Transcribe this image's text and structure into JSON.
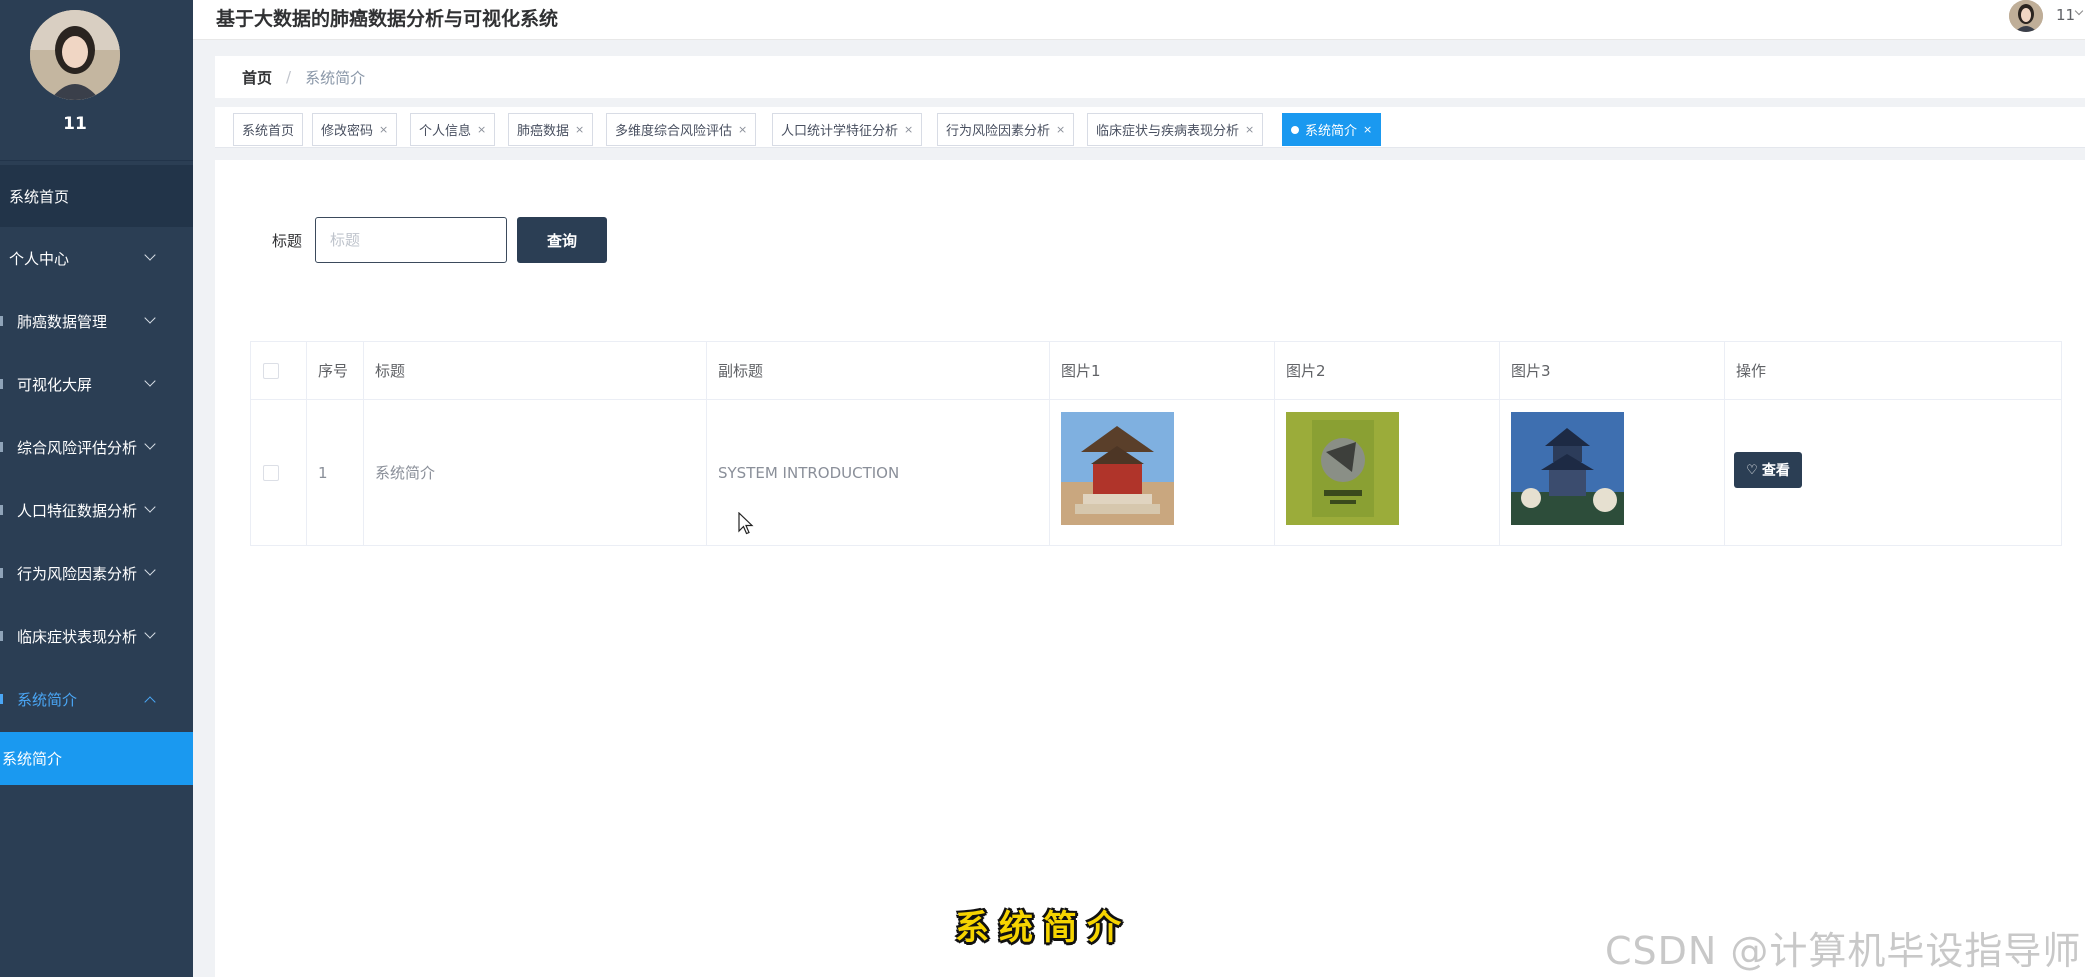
{
  "app": {
    "title": "基于大数据的肺癌数据分析与可视化系统"
  },
  "user": {
    "name": "11",
    "top_name": "11"
  },
  "sidebar": {
    "items": [
      {
        "label": "系统首页"
      },
      {
        "label": "个人中心"
      },
      {
        "label": "肺癌数据管理"
      },
      {
        "label": "可视化大屏"
      },
      {
        "label": "综合风险评估分析"
      },
      {
        "label": "人口特征数据分析"
      },
      {
        "label": "行为风险因素分析"
      },
      {
        "label": "临床症状表现分析"
      },
      {
        "label": "系统简介"
      }
    ],
    "submenu": {
      "label": "系统简介"
    }
  },
  "breadcrumb": {
    "home": "首页",
    "separator": "/",
    "current": "系统简介"
  },
  "tabs": [
    {
      "label": "系统首页",
      "closable": false
    },
    {
      "label": "修改密码",
      "closable": true
    },
    {
      "label": "个人信息",
      "closable": true
    },
    {
      "label": "肺癌数据",
      "closable": true
    },
    {
      "label": "多维度综合风险评估",
      "closable": true
    },
    {
      "label": "人口统计学特征分析",
      "closable": true
    },
    {
      "label": "行为风险因素分析",
      "closable": true
    },
    {
      "label": "临床症状与疾病表现分析",
      "closable": true
    },
    {
      "label": "系统简介",
      "closable": true,
      "active": true
    }
  ],
  "tab_close": "×",
  "search": {
    "label": "标题",
    "placeholder": "标题",
    "value": "",
    "button": "查询"
  },
  "table": {
    "columns": [
      "序号",
      "标题",
      "副标题",
      "图片1",
      "图片2",
      "图片3",
      "操作"
    ],
    "rows": [
      {
        "index": "1",
        "title": "系统简介",
        "subtitle": "SYSTEM INTRODUCTION",
        "action": "查看"
      }
    ]
  },
  "overlay": {
    "caption": "系统简介",
    "watermark": "CSDN @计算机毕设指导师"
  },
  "colors": {
    "sidebar": "#2b3e54",
    "accent": "#1a99f0",
    "dark_button": "#2b3e54"
  }
}
